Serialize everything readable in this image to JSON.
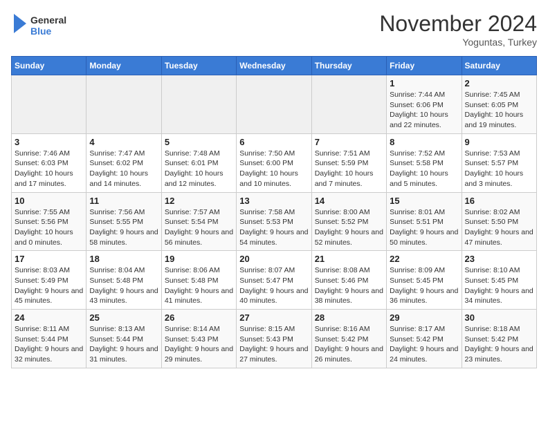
{
  "logo": {
    "text_general": "General",
    "text_blue": "Blue"
  },
  "title": "November 2024",
  "subtitle": "Yoguntas, Turkey",
  "weekdays": [
    "Sunday",
    "Monday",
    "Tuesday",
    "Wednesday",
    "Thursday",
    "Friday",
    "Saturday"
  ],
  "weeks": [
    [
      {
        "day": "",
        "info": ""
      },
      {
        "day": "",
        "info": ""
      },
      {
        "day": "",
        "info": ""
      },
      {
        "day": "",
        "info": ""
      },
      {
        "day": "",
        "info": ""
      },
      {
        "day": "1",
        "info": "Sunrise: 7:44 AM\nSunset: 6:06 PM\nDaylight: 10 hours and 22 minutes."
      },
      {
        "day": "2",
        "info": "Sunrise: 7:45 AM\nSunset: 6:05 PM\nDaylight: 10 hours and 19 minutes."
      }
    ],
    [
      {
        "day": "3",
        "info": "Sunrise: 7:46 AM\nSunset: 6:03 PM\nDaylight: 10 hours and 17 minutes."
      },
      {
        "day": "4",
        "info": "Sunrise: 7:47 AM\nSunset: 6:02 PM\nDaylight: 10 hours and 14 minutes."
      },
      {
        "day": "5",
        "info": "Sunrise: 7:48 AM\nSunset: 6:01 PM\nDaylight: 10 hours and 12 minutes."
      },
      {
        "day": "6",
        "info": "Sunrise: 7:50 AM\nSunset: 6:00 PM\nDaylight: 10 hours and 10 minutes."
      },
      {
        "day": "7",
        "info": "Sunrise: 7:51 AM\nSunset: 5:59 PM\nDaylight: 10 hours and 7 minutes."
      },
      {
        "day": "8",
        "info": "Sunrise: 7:52 AM\nSunset: 5:58 PM\nDaylight: 10 hours and 5 minutes."
      },
      {
        "day": "9",
        "info": "Sunrise: 7:53 AM\nSunset: 5:57 PM\nDaylight: 10 hours and 3 minutes."
      }
    ],
    [
      {
        "day": "10",
        "info": "Sunrise: 7:55 AM\nSunset: 5:56 PM\nDaylight: 10 hours and 0 minutes."
      },
      {
        "day": "11",
        "info": "Sunrise: 7:56 AM\nSunset: 5:55 PM\nDaylight: 9 hours and 58 minutes."
      },
      {
        "day": "12",
        "info": "Sunrise: 7:57 AM\nSunset: 5:54 PM\nDaylight: 9 hours and 56 minutes."
      },
      {
        "day": "13",
        "info": "Sunrise: 7:58 AM\nSunset: 5:53 PM\nDaylight: 9 hours and 54 minutes."
      },
      {
        "day": "14",
        "info": "Sunrise: 8:00 AM\nSunset: 5:52 PM\nDaylight: 9 hours and 52 minutes."
      },
      {
        "day": "15",
        "info": "Sunrise: 8:01 AM\nSunset: 5:51 PM\nDaylight: 9 hours and 50 minutes."
      },
      {
        "day": "16",
        "info": "Sunrise: 8:02 AM\nSunset: 5:50 PM\nDaylight: 9 hours and 47 minutes."
      }
    ],
    [
      {
        "day": "17",
        "info": "Sunrise: 8:03 AM\nSunset: 5:49 PM\nDaylight: 9 hours and 45 minutes."
      },
      {
        "day": "18",
        "info": "Sunrise: 8:04 AM\nSunset: 5:48 PM\nDaylight: 9 hours and 43 minutes."
      },
      {
        "day": "19",
        "info": "Sunrise: 8:06 AM\nSunset: 5:48 PM\nDaylight: 9 hours and 41 minutes."
      },
      {
        "day": "20",
        "info": "Sunrise: 8:07 AM\nSunset: 5:47 PM\nDaylight: 9 hours and 40 minutes."
      },
      {
        "day": "21",
        "info": "Sunrise: 8:08 AM\nSunset: 5:46 PM\nDaylight: 9 hours and 38 minutes."
      },
      {
        "day": "22",
        "info": "Sunrise: 8:09 AM\nSunset: 5:45 PM\nDaylight: 9 hours and 36 minutes."
      },
      {
        "day": "23",
        "info": "Sunrise: 8:10 AM\nSunset: 5:45 PM\nDaylight: 9 hours and 34 minutes."
      }
    ],
    [
      {
        "day": "24",
        "info": "Sunrise: 8:11 AM\nSunset: 5:44 PM\nDaylight: 9 hours and 32 minutes."
      },
      {
        "day": "25",
        "info": "Sunrise: 8:13 AM\nSunset: 5:44 PM\nDaylight: 9 hours and 31 minutes."
      },
      {
        "day": "26",
        "info": "Sunrise: 8:14 AM\nSunset: 5:43 PM\nDaylight: 9 hours and 29 minutes."
      },
      {
        "day": "27",
        "info": "Sunrise: 8:15 AM\nSunset: 5:43 PM\nDaylight: 9 hours and 27 minutes."
      },
      {
        "day": "28",
        "info": "Sunrise: 8:16 AM\nSunset: 5:42 PM\nDaylight: 9 hours and 26 minutes."
      },
      {
        "day": "29",
        "info": "Sunrise: 8:17 AM\nSunset: 5:42 PM\nDaylight: 9 hours and 24 minutes."
      },
      {
        "day": "30",
        "info": "Sunrise: 8:18 AM\nSunset: 5:42 PM\nDaylight: 9 hours and 23 minutes."
      }
    ]
  ]
}
